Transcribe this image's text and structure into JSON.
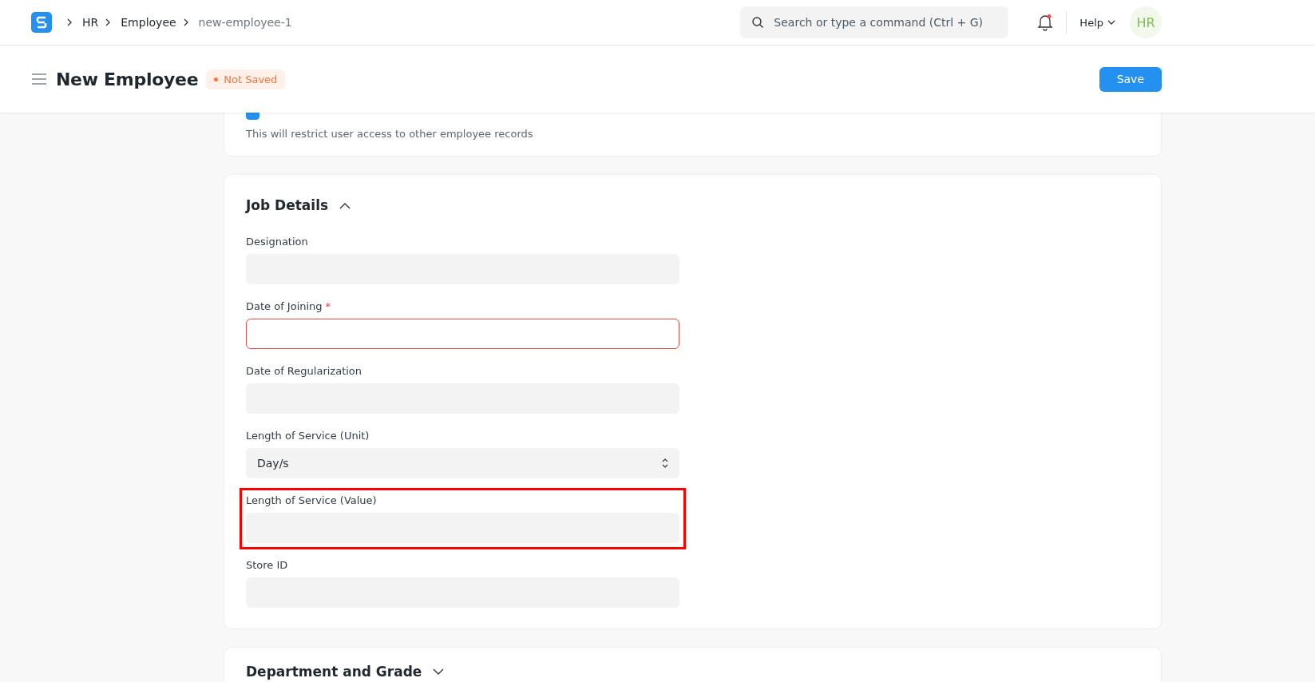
{
  "navbar": {
    "breadcrumbs": [
      {
        "label": "HR",
        "current": false
      },
      {
        "label": "Employee",
        "current": false
      },
      {
        "label": "new-employee-1",
        "current": true
      }
    ],
    "search": {
      "placeholder": "Search or type a command (Ctrl + G)"
    },
    "notifications": {
      "unread": true
    },
    "help": "Help",
    "avatar": "HR"
  },
  "page_header": {
    "title": "New Employee",
    "status": "Not Saved",
    "save": "Save"
  },
  "permission_card": {
    "checkbox": {
      "checked": true
    },
    "description": "This will restrict user access to other employee records"
  },
  "sections": [
    {
      "title": "Job Details",
      "expanded": true,
      "fields": [
        {
          "kind": "input",
          "label": "Designation",
          "required": false,
          "highlighted": false
        },
        {
          "kind": "input",
          "label": "Date of Joining",
          "required": true,
          "highlighted": false
        },
        {
          "kind": "input",
          "label": "Date of Regularization",
          "required": false,
          "highlighted": false
        },
        {
          "kind": "select",
          "label": "Length of Service (Unit)",
          "value": "Day/s",
          "required": false,
          "highlighted": false
        },
        {
          "kind": "input",
          "label": "Length of Service (Value)",
          "required": false,
          "highlighted": true
        },
        {
          "kind": "input",
          "label": "Store ID",
          "required": false,
          "highlighted": false
        }
      ]
    },
    {
      "title": "Department and Grade",
      "expanded": false
    }
  ],
  "required_symbol": "*"
}
